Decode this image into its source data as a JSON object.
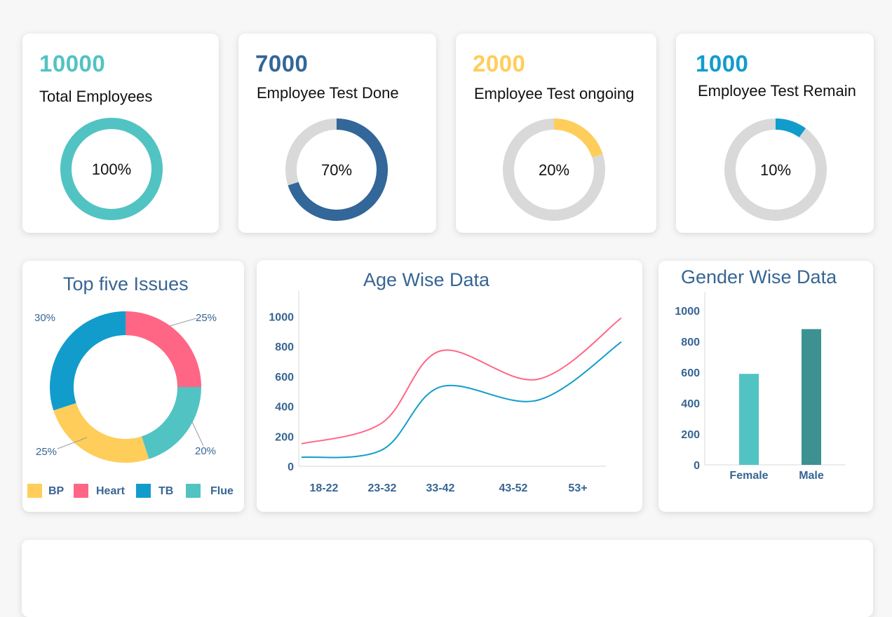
{
  "kpis": [
    {
      "value": "10000",
      "label": "Total Employees",
      "percent": 100,
      "percent_label": "100%",
      "color": "#52c3c3"
    },
    {
      "value": "7000",
      "label": "Employee Test Done",
      "percent": 70,
      "percent_label": "70%",
      "color": "#336699"
    },
    {
      "value": "2000",
      "label": "Employee Test ongoing",
      "percent": 20,
      "percent_label": "20%",
      "color": "#ffcd5a"
    },
    {
      "value": "1000",
      "label": "Employee Test Remain",
      "percent": 10,
      "percent_label": "10%",
      "color": "#129ccc"
    }
  ],
  "issues": {
    "title": "Top five Issues",
    "legend": [
      {
        "label": "BP",
        "color": "#ffcd5a"
      },
      {
        "label": "Heart",
        "color": "#ff6685"
      },
      {
        "label": "TB",
        "color": "#129ccc"
      },
      {
        "label": "Flue",
        "color": "#52c3c3"
      }
    ]
  },
  "age": {
    "title": "Age Wise Data"
  },
  "gender": {
    "title": "Gender Wise Data"
  },
  "chart_data": [
    {
      "type": "pie",
      "title": "Top five Issues",
      "series": [
        {
          "name": "Heart",
          "value": 25,
          "label": "25%",
          "color": "#ff6685"
        },
        {
          "name": "Flue",
          "value": 20,
          "label": "20%",
          "color": "#52c3c3"
        },
        {
          "name": "BP",
          "value": 25,
          "label": "25%",
          "color": "#ffcd5a"
        },
        {
          "name": "TB",
          "value": 30,
          "label": "30%",
          "color": "#129ccc"
        }
      ]
    },
    {
      "type": "line",
      "title": "Age Wise Data",
      "categories": [
        "18-22",
        "23-32",
        "33-42",
        "43-52",
        "53+"
      ],
      "y_ticks": [
        0,
        200,
        400,
        600,
        800,
        1000
      ],
      "ylim": [
        0,
        1100
      ],
      "series": [
        {
          "color": "#ff6685",
          "values": [
            150,
            290,
            770,
            580,
            990
          ]
        },
        {
          "color": "#129ccc",
          "values": [
            60,
            110,
            530,
            440,
            830
          ]
        }
      ]
    },
    {
      "type": "bar",
      "title": "Gender Wise Data",
      "categories": [
        "Female",
        "Male"
      ],
      "values": [
        590,
        880
      ],
      "colors": [
        "#52c3c3",
        "#3d9191"
      ],
      "y_ticks": [
        0,
        200,
        400,
        600,
        800,
        1000
      ],
      "ylim": [
        0,
        1100
      ]
    }
  ]
}
